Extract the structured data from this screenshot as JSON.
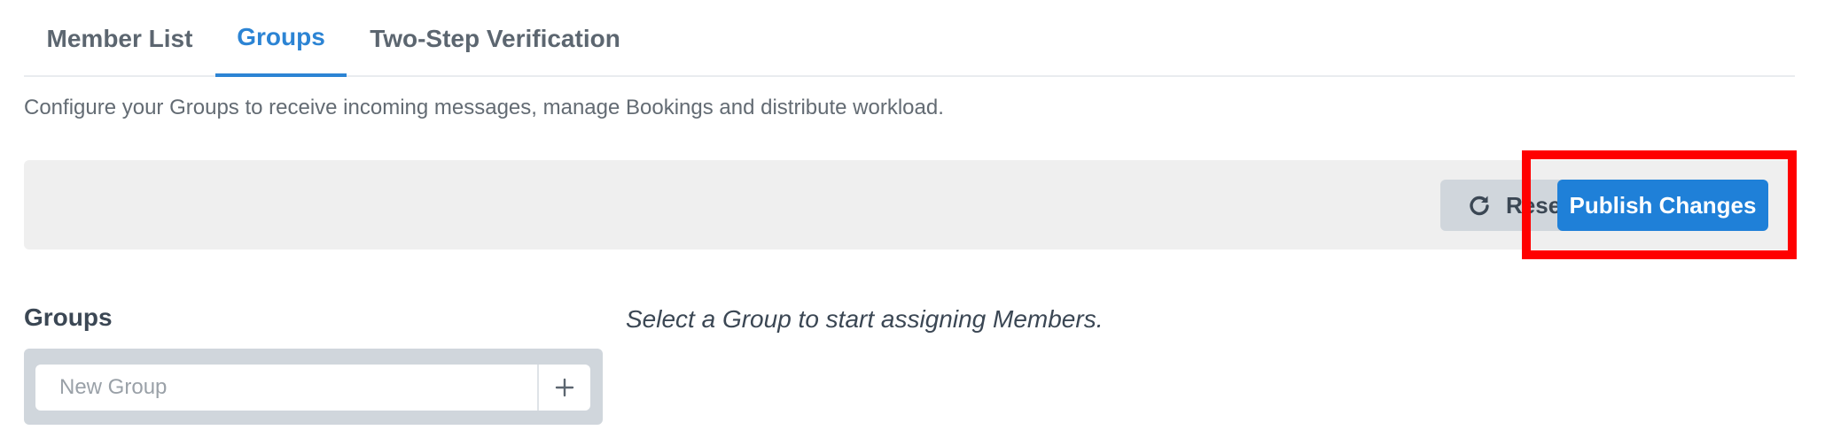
{
  "tabs": [
    {
      "label": "Member List",
      "active": false
    },
    {
      "label": "Groups",
      "active": true
    },
    {
      "label": "Two-Step Verification",
      "active": false
    }
  ],
  "description": "Configure your Groups to receive incoming messages, manage Bookings and distribute workload.",
  "toolbar": {
    "reset_label": "Reset",
    "reset_icon": "refresh-icon",
    "publish_label": "Publish Changes"
  },
  "groups": {
    "heading": "Groups",
    "new_group_placeholder": "New Group",
    "new_group_value": "",
    "add_icon": "plus-icon"
  },
  "main": {
    "empty_hint": "Select a Group to start assigning Members."
  },
  "colors": {
    "accent": "#1f80d8",
    "active_tab": "#2c84d4",
    "toolbar_bg": "#efefef",
    "secondary_button": "#d0d6dc",
    "highlight": "#ff0000"
  }
}
